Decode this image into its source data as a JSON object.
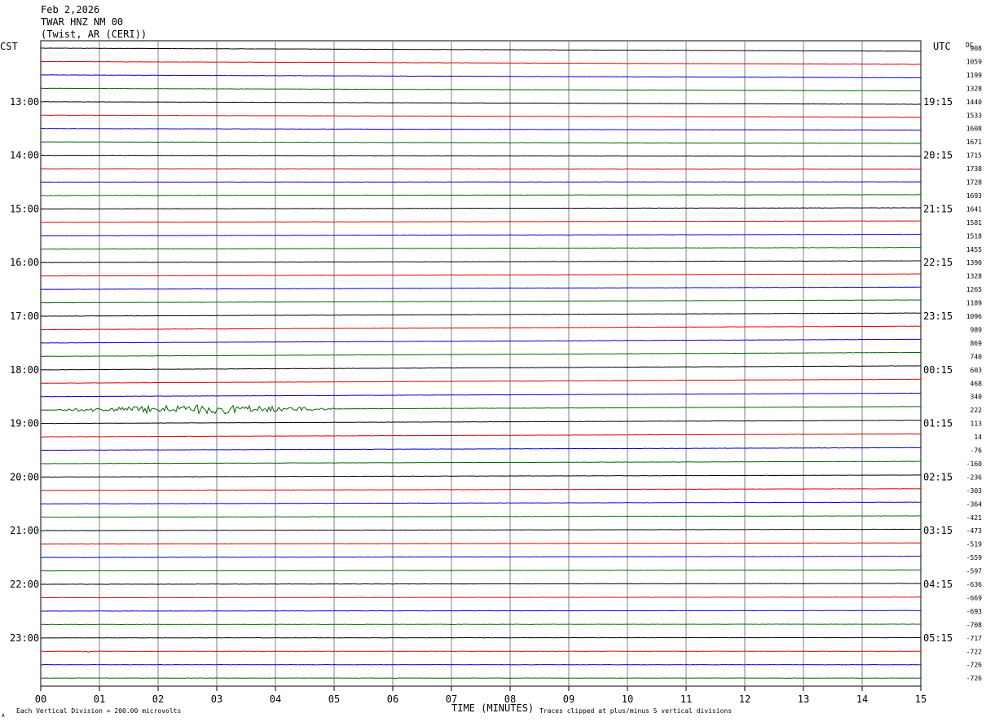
{
  "header": {
    "date": "Feb 2,2026",
    "station": "TWAR HNZ NM 00",
    "location": "(Twist, AR (CERI))"
  },
  "labels": {
    "left_zone": "CST",
    "right_zone": "UTC",
    "dc_header": "DC",
    "x_axis_title": "TIME (MINUTES)",
    "scale_note": "Each Vertical Division =  200.00 microvolts",
    "clip_note": "Traces clipped at plus/minus 5 vertical divisions",
    "corner_mark": "A"
  },
  "colors": {
    "background": "#ffffff",
    "grid": "#7d7d9c",
    "trace_cycle": [
      "#000000",
      "#e00000",
      "#0000d0",
      "#006600"
    ]
  },
  "chart_data": {
    "type": "line",
    "description_free": true,
    "x": {
      "min": 0,
      "max": 15,
      "ticks": [
        "00",
        "01",
        "02",
        "03",
        "04",
        "05",
        "06",
        "07",
        "08",
        "09",
        "10",
        "11",
        "12",
        "13",
        "14",
        "15"
      ]
    },
    "hour_labels_cst": [
      {
        "trace": 4,
        "label": "13:00"
      },
      {
        "trace": 8,
        "label": "14:00"
      },
      {
        "trace": 12,
        "label": "15:00"
      },
      {
        "trace": 16,
        "label": "16:00"
      },
      {
        "trace": 20,
        "label": "17:00"
      },
      {
        "trace": 24,
        "label": "18:00"
      },
      {
        "trace": 28,
        "label": "19:00"
      },
      {
        "trace": 32,
        "label": "20:00"
      },
      {
        "trace": 36,
        "label": "21:00"
      },
      {
        "trace": 40,
        "label": "22:00"
      },
      {
        "trace": 44,
        "label": "23:00"
      }
    ],
    "hour_labels_utc": [
      {
        "trace": 4,
        "label": "19:15"
      },
      {
        "trace": 8,
        "label": "20:15"
      },
      {
        "trace": 12,
        "label": "21:15"
      },
      {
        "trace": 16,
        "label": "22:15"
      },
      {
        "trace": 20,
        "label": "23:15"
      },
      {
        "trace": 24,
        "label": "00:15"
      },
      {
        "trace": 28,
        "label": "01:15"
      },
      {
        "trace": 32,
        "label": "02:15"
      },
      {
        "trace": 36,
        "label": "03:15"
      },
      {
        "trace": 40,
        "label": "04:15"
      },
      {
        "trace": 44,
        "label": "05:15"
      }
    ],
    "dc_offsets": [
      "908",
      "1059",
      "1199",
      "1328",
      "1440",
      "1533",
      "1608",
      "1671",
      "1715",
      "1738",
      "1728",
      "1693",
      "1641",
      "1581",
      "1518",
      "1455",
      "1390",
      "1328",
      "1265",
      "1189",
      "1096",
      "989",
      "869",
      "740",
      "603",
      "468",
      "340",
      "222",
      "113",
      "14",
      "-76",
      "-160",
      "-236",
      "-303",
      "-364",
      "-421",
      "-473",
      "-519",
      "-559",
      "-597",
      "-636",
      "-669",
      "-693",
      "-708",
      "-717",
      "-722",
      "-726",
      "-726"
    ],
    "trace_count": 48,
    "trace_drift_divisions": [
      {
        "trace": 0,
        "start": 0.0,
        "end": -1.1
      },
      {
        "trace": 1,
        "start": 0.0,
        "end": -1.0
      },
      {
        "trace": 2,
        "start": 0.0,
        "end": -1.0
      },
      {
        "trace": 3,
        "start": 0.0,
        "end": -0.9
      },
      {
        "trace": 4,
        "start": 0.0,
        "end": -0.9
      },
      {
        "trace": 5,
        "start": 0.0,
        "end": -0.8
      },
      {
        "trace": 6,
        "start": 0.0,
        "end": -0.6
      },
      {
        "trace": 7,
        "start": 0.0,
        "end": -0.5
      },
      {
        "trace": 8,
        "start": 0.0,
        "end": -0.3
      },
      {
        "trace": 9,
        "start": 0.0,
        "end": -0.1
      },
      {
        "trace": 10,
        "start": 0.0,
        "end": 0.1
      },
      {
        "trace": 11,
        "start": 0.0,
        "end": 0.3
      },
      {
        "trace": 12,
        "start": 0.0,
        "end": 0.4
      },
      {
        "trace": 13,
        "start": 0.0,
        "end": 0.5
      },
      {
        "trace": 14,
        "start": 0.0,
        "end": 0.5
      },
      {
        "trace": 15,
        "start": 0.0,
        "end": 0.6
      },
      {
        "trace": 16,
        "start": 0.0,
        "end": 0.6
      },
      {
        "trace": 17,
        "start": 0.0,
        "end": 0.7
      },
      {
        "trace": 18,
        "start": 0.0,
        "end": 0.8
      },
      {
        "trace": 19,
        "start": 0.0,
        "end": 1.0
      },
      {
        "trace": 20,
        "start": 0.0,
        "end": 1.1
      },
      {
        "trace": 21,
        "start": 0.0,
        "end": 1.2
      },
      {
        "trace": 22,
        "start": 0.0,
        "end": 1.3
      },
      {
        "trace": 23,
        "start": 0.0,
        "end": 1.4
      },
      {
        "trace": 24,
        "start": 0.0,
        "end": 1.4
      },
      {
        "trace": 25,
        "start": 0.0,
        "end": 1.4
      },
      {
        "trace": 26,
        "start": 0.0,
        "end": 1.2
      },
      {
        "trace": 27,
        "start": 0.0,
        "end": 1.2
      },
      {
        "trace": 28,
        "start": 0.0,
        "end": 1.1
      },
      {
        "trace": 29,
        "start": 0.0,
        "end": 1.0
      },
      {
        "trace": 30,
        "start": 0.0,
        "end": 0.9
      },
      {
        "trace": 31,
        "start": 0.0,
        "end": 0.8
      },
      {
        "trace": 32,
        "start": 0.0,
        "end": 0.7
      },
      {
        "trace": 33,
        "start": 0.0,
        "end": 0.6
      },
      {
        "trace": 34,
        "start": 0.0,
        "end": 0.6
      },
      {
        "trace": 35,
        "start": 0.0,
        "end": 0.5
      },
      {
        "trace": 36,
        "start": 0.0,
        "end": 0.5
      },
      {
        "trace": 37,
        "start": 0.0,
        "end": 0.4
      },
      {
        "trace": 38,
        "start": 0.0,
        "end": 0.4
      },
      {
        "trace": 39,
        "start": 0.0,
        "end": 0.3
      },
      {
        "trace": 40,
        "start": 0.0,
        "end": 0.3
      },
      {
        "trace": 41,
        "start": 0.0,
        "end": 0.2
      },
      {
        "trace": 42,
        "start": 0.0,
        "end": 0.2
      },
      {
        "trace": 43,
        "start": 0.0,
        "end": 0.1
      },
      {
        "trace": 44,
        "start": 0.0,
        "end": 0.1
      },
      {
        "trace": 45,
        "start": 0.0,
        "end": 0.0
      },
      {
        "trace": 46,
        "start": 0.0,
        "end": 0.0
      },
      {
        "trace": 47,
        "start": 0.0,
        "end": 0.0
      }
    ],
    "events": [
      {
        "trace": 27,
        "start_min": 0.3,
        "peak_min": 2.7,
        "end_min": 5.0,
        "peak_amplitude_divisions": 1.0
      },
      {
        "trace": 45,
        "start_min": 0.7,
        "peak_min": 0.78,
        "end_min": 0.85,
        "peak_amplitude_divisions": 0.3
      }
    ],
    "grid": true
  }
}
